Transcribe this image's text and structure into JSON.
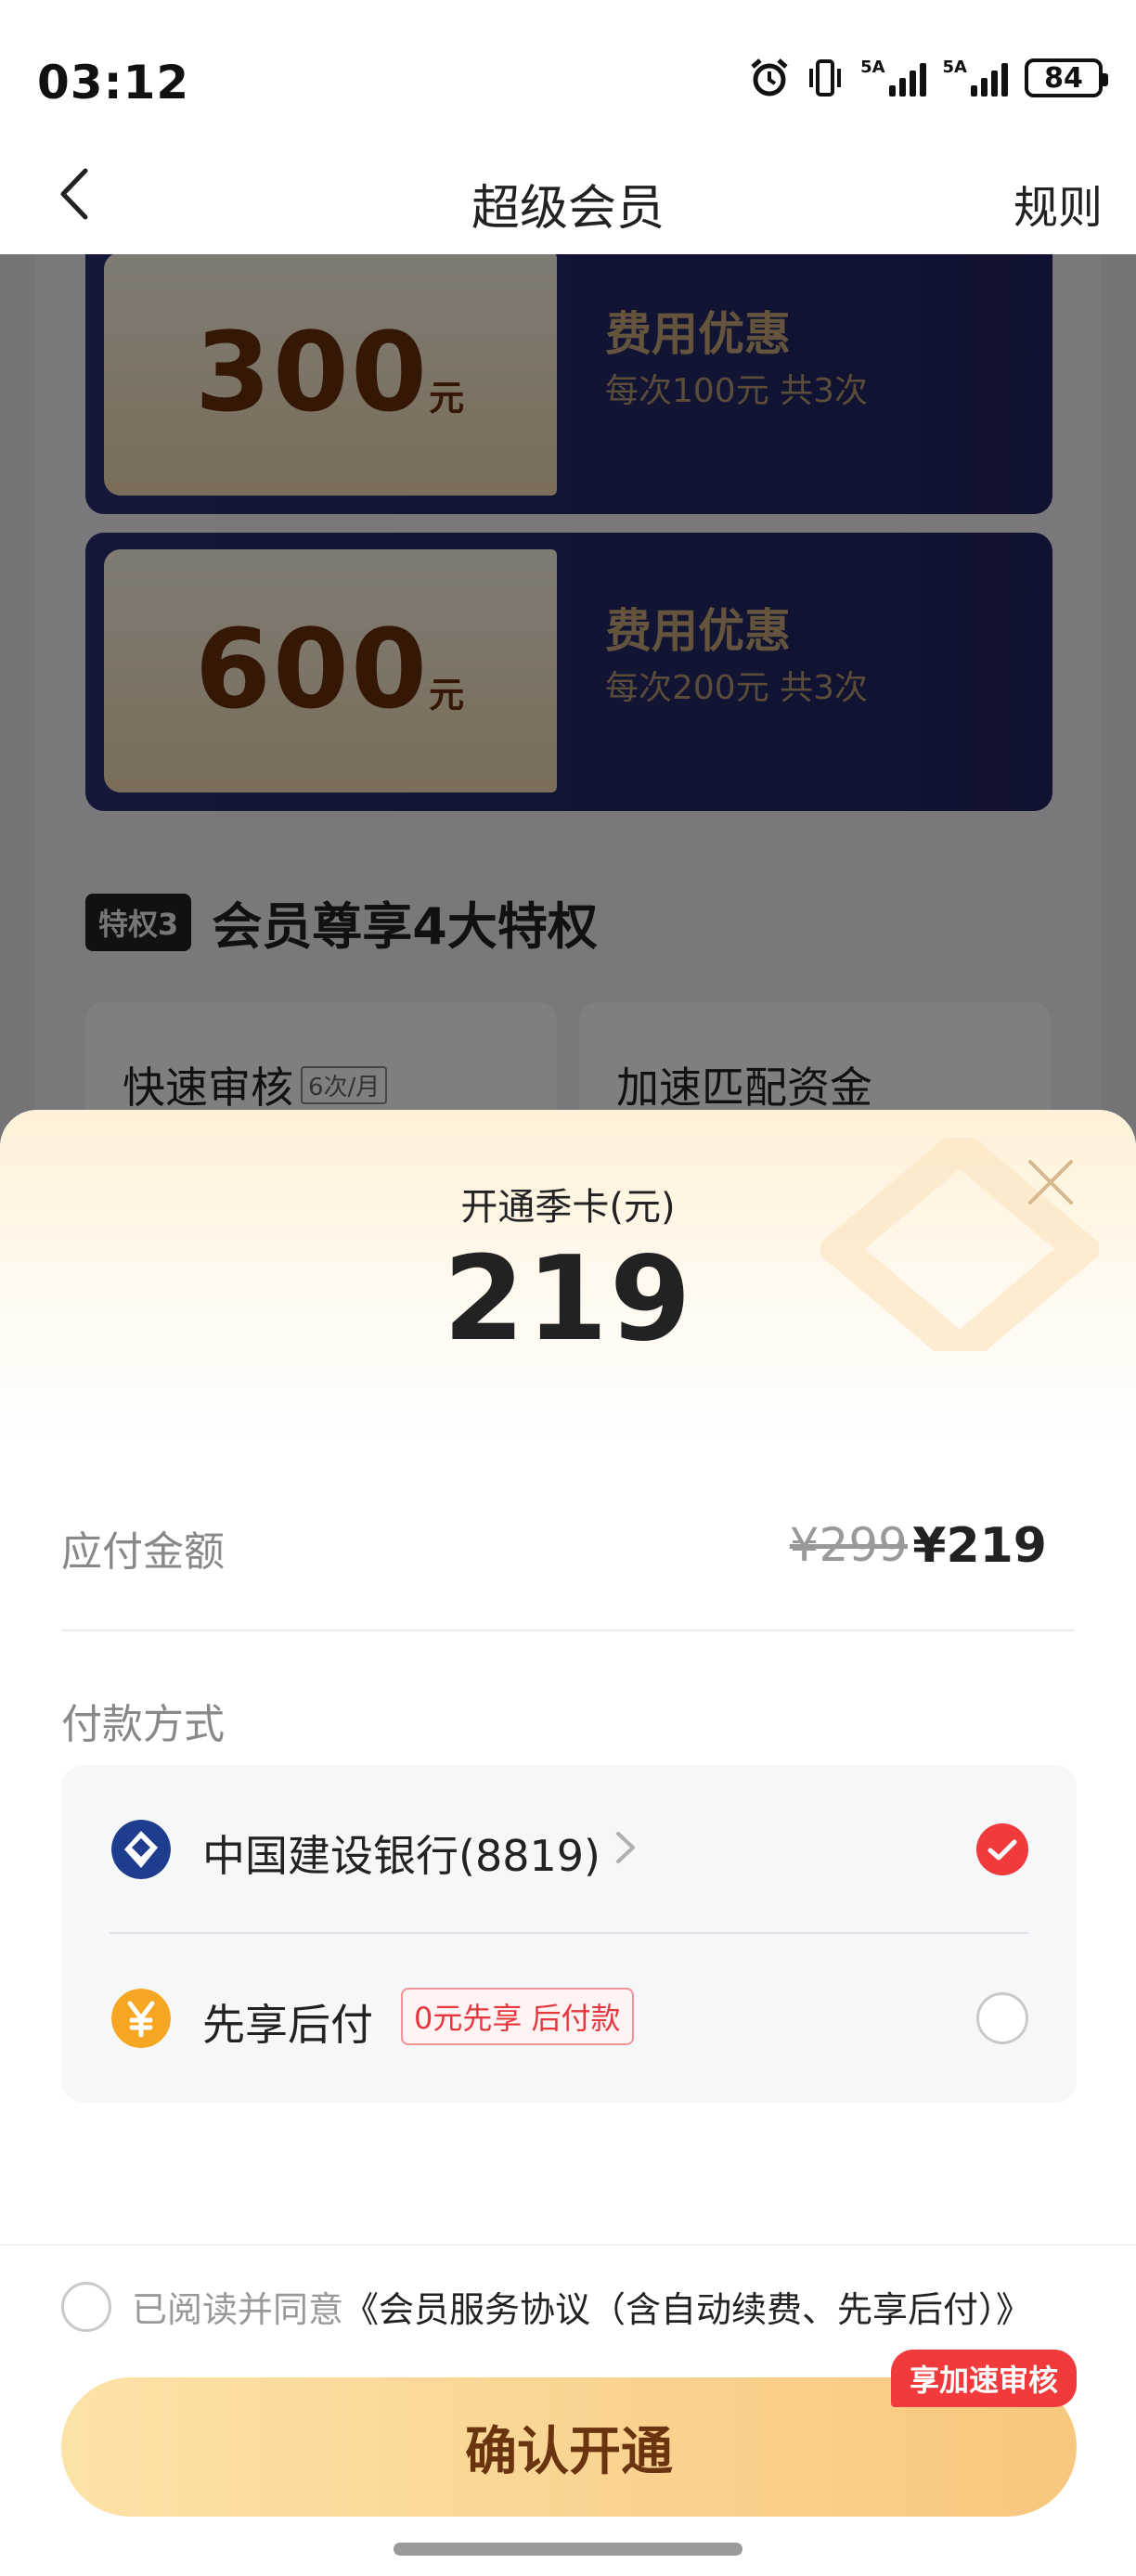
{
  "status_bar": {
    "time": "03:12",
    "battery": "84",
    "signal_label_1": "5A",
    "signal_label_2": "5A",
    "icons": [
      "alarm-icon",
      "vibrate-icon",
      "signal-icon",
      "signal-icon",
      "battery-icon"
    ]
  },
  "nav": {
    "title": "超级会员",
    "right_link": "规则",
    "back_icon": "chevron-left-icon"
  },
  "background": {
    "coupons": [
      {
        "amount": "300",
        "unit": "元",
        "title": "费用优惠",
        "subtitle": "每次100元 共3次"
      },
      {
        "amount": "600",
        "unit": "元",
        "title": "费用优惠",
        "subtitle": "每次200元 共3次"
      }
    ],
    "privilege": {
      "badge": "特权3",
      "title": "会员尊享4大特权",
      "cards": [
        {
          "label": "快速审核",
          "tag": "6次/月"
        },
        {
          "label": "加速匹配资金",
          "tag": ""
        }
      ]
    }
  },
  "sheet": {
    "subtitle": "开通季卡(元)",
    "price": "219",
    "payable_label": "应付金额",
    "original_price": "¥299",
    "final_price": "¥219",
    "payment_method_label": "付款方式",
    "payment_methods": [
      {
        "name": "中国建设银行(8819)",
        "icon": "ccb-bank-icon",
        "selected": true,
        "tag": ""
      },
      {
        "name": "先享后付",
        "icon": "yuan-coin-icon",
        "selected": false,
        "tag": "0元先享 后付款"
      }
    ],
    "agreement_prefix": "已阅读并同意",
    "agreement_link": "《会员服务协议（含自动续费、先享后付）》",
    "confirm_label": "确认开通",
    "confirm_badge": "享加速审核"
  },
  "colors": {
    "accent_red": "#f03a3c",
    "confirm_gold_start": "#fde2a6",
    "confirm_gold_end": "#f7c77e",
    "coupon_navy": "#2a2f72"
  }
}
